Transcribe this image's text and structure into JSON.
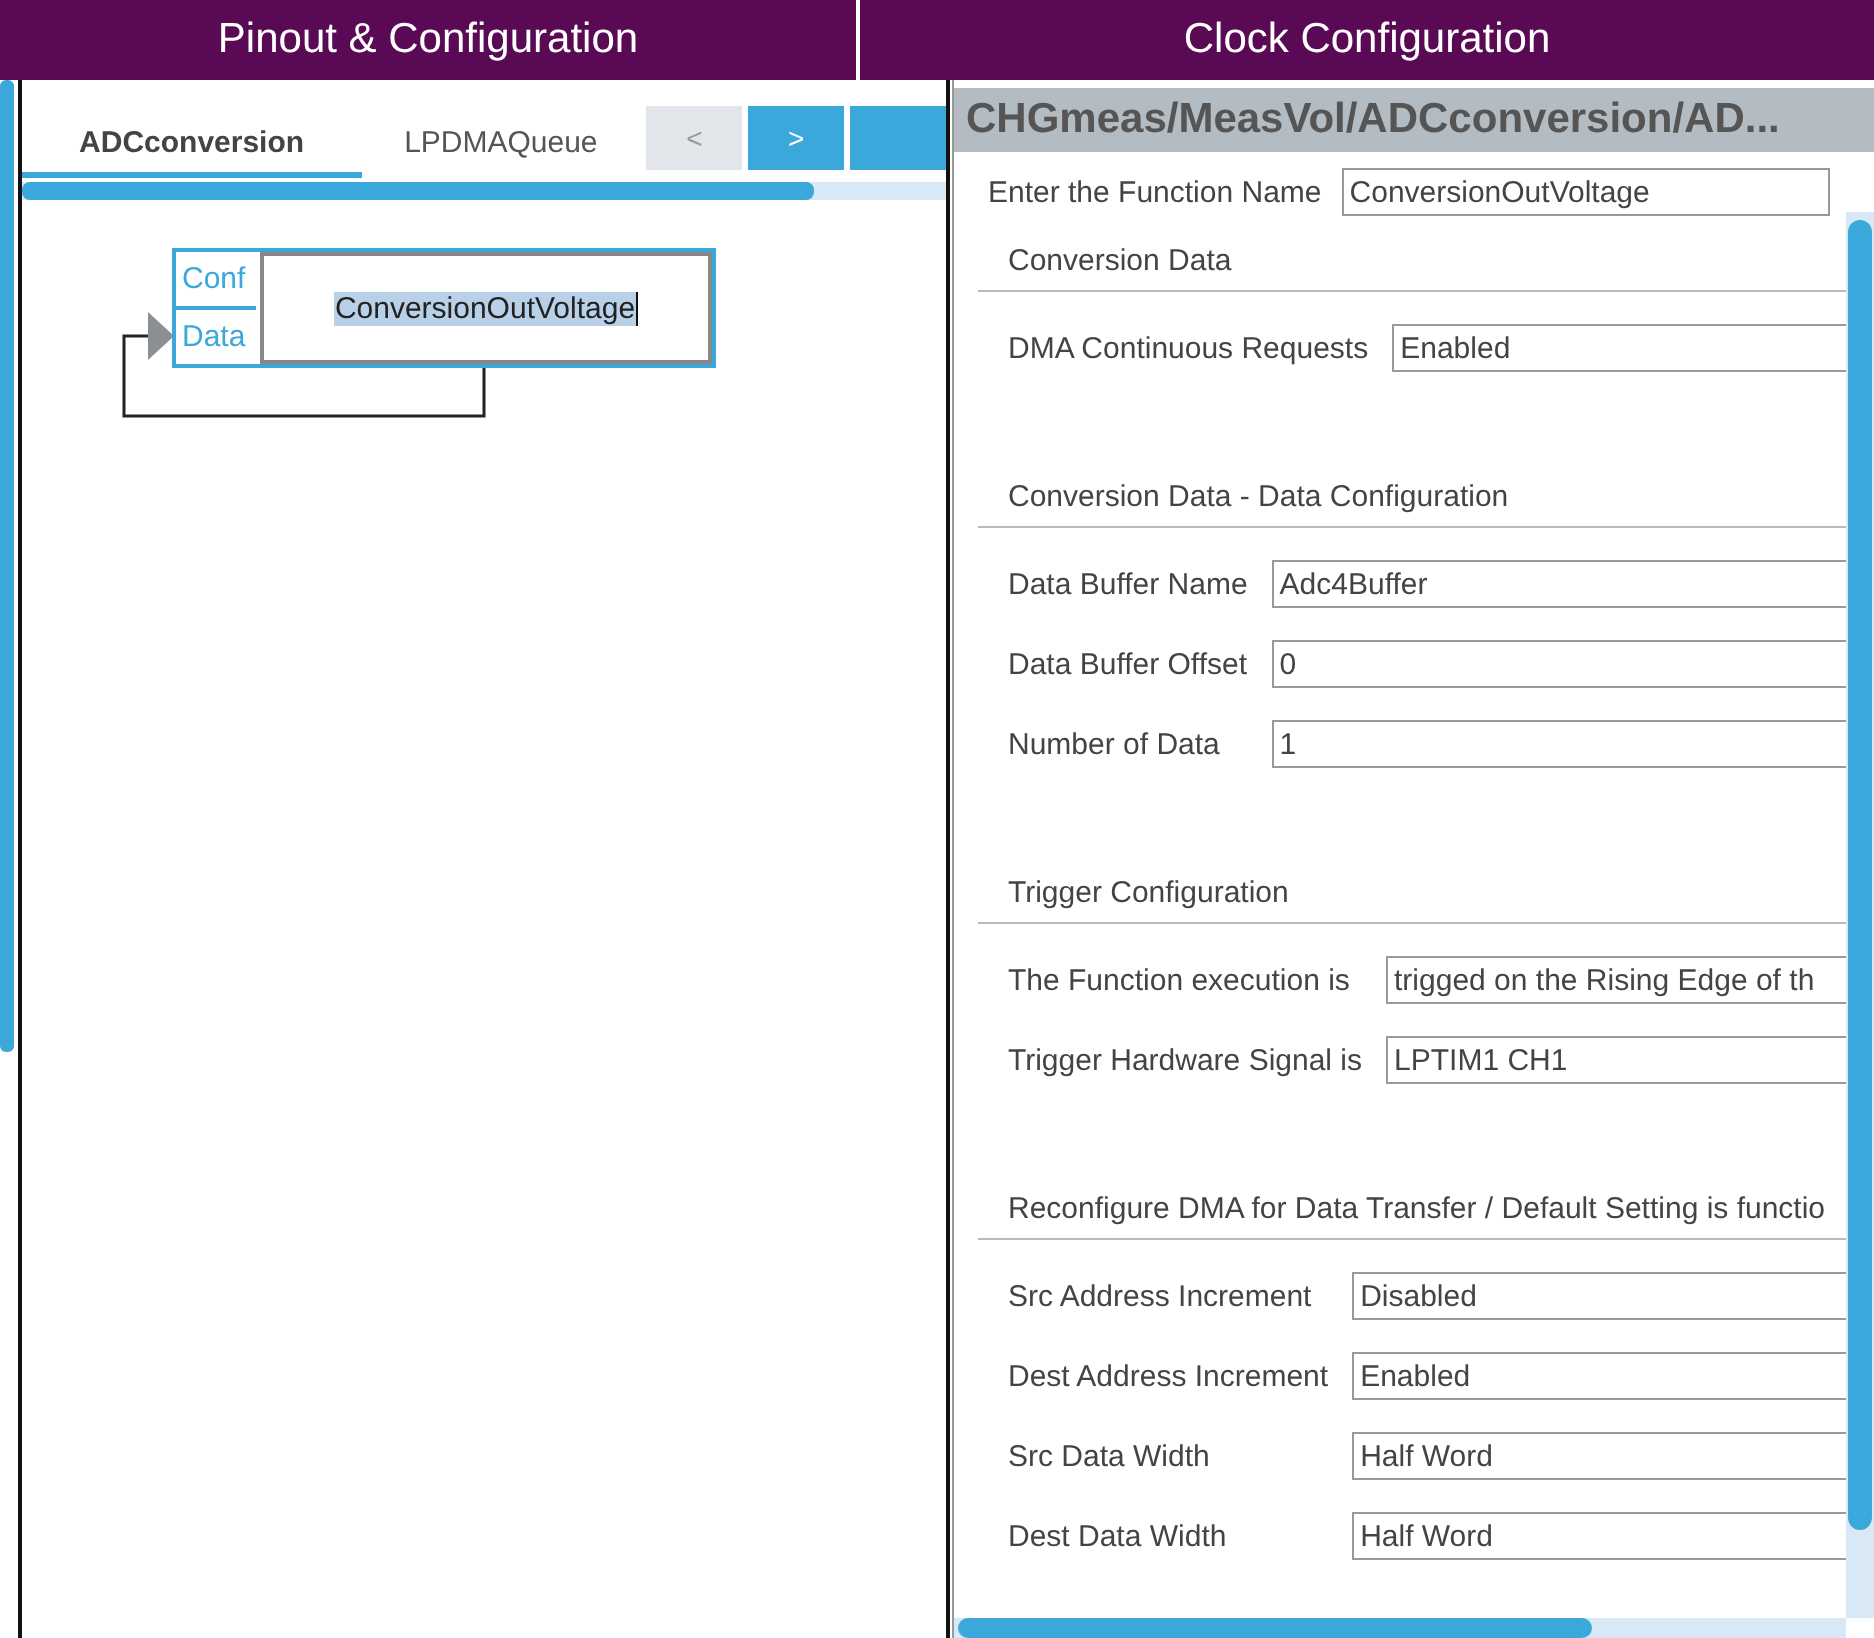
{
  "header": {
    "tabs": [
      {
        "label": "Pinout & Configuration"
      },
      {
        "label": "Clock Configuration"
      }
    ]
  },
  "left": {
    "tabs": [
      {
        "label": "ADCconversion",
        "selected": true
      },
      {
        "label": "LPDMAQueue",
        "selected": false
      }
    ],
    "nav_buttons": [
      {
        "label": "<",
        "disabled": true
      },
      {
        "label": ">",
        "disabled": false
      },
      {
        "disabled": false
      }
    ],
    "block": {
      "ports": [
        "Conf",
        "Data"
      ],
      "name": "ConversionOutVoltage"
    }
  },
  "right": {
    "title": "CHGmeas/MeasVol/ADCconversion/AD...",
    "function_name": {
      "label": "Enter the Function Name",
      "value": "ConversionOutVoltage"
    },
    "sections": [
      {
        "title": "Conversion Data",
        "rows": [
          {
            "label": "DMA Continuous Requests",
            "value": "Enabled"
          }
        ]
      },
      {
        "title": "Conversion Data - Data Configuration",
        "rows": [
          {
            "label": "Data Buffer Name",
            "value": "Adc4Buffer"
          },
          {
            "label": "Data Buffer Offset",
            "value": "0"
          },
          {
            "label": "Number of Data",
            "value": "1"
          }
        ]
      },
      {
        "title": "Trigger Configuration",
        "rows": [
          {
            "label": "The Function execution is",
            "value": "trigged on the Rising Edge of th"
          },
          {
            "label": "Trigger Hardware Signal is",
            "value": "LPTIM1 CH1"
          }
        ]
      },
      {
        "title": "Reconfigure DMA for Data Transfer / Default Setting is functio",
        "rows": [
          {
            "label": "Src Address Increment",
            "value": "Disabled"
          },
          {
            "label": "Dest Address Increment",
            "value": "Enabled"
          },
          {
            "label": "Src Data Width",
            "value": "Half Word"
          },
          {
            "label": "Dest Data Width",
            "value": "Half Word"
          }
        ]
      }
    ]
  }
}
